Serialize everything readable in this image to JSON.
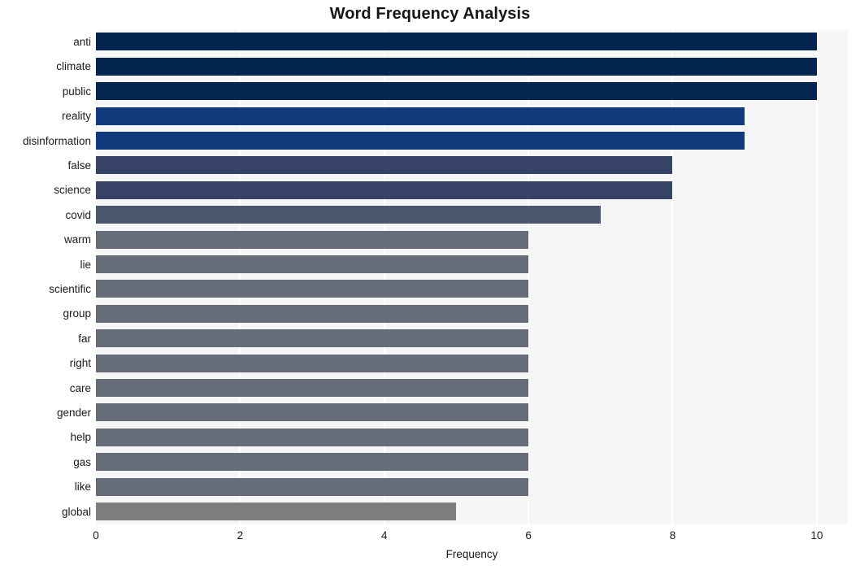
{
  "chart_data": {
    "type": "bar",
    "orientation": "horizontal",
    "title": "Word Frequency Analysis",
    "xlabel": "Frequency",
    "ylabel": "",
    "categories": [
      "anti",
      "climate",
      "public",
      "reality",
      "disinformation",
      "false",
      "science",
      "covid",
      "warm",
      "lie",
      "scientific",
      "group",
      "far",
      "right",
      "care",
      "gender",
      "help",
      "gas",
      "like",
      "global"
    ],
    "values": [
      10,
      10,
      10,
      9,
      9,
      8,
      8,
      7,
      6,
      6,
      6,
      6,
      6,
      6,
      6,
      6,
      6,
      6,
      6,
      5
    ],
    "bar_colors": [
      "#042450",
      "#042450",
      "#042550",
      "#103a7c",
      "#103a7c",
      "#374267",
      "#374267",
      "#4d566f",
      "#666c78",
      "#666c78",
      "#666c78",
      "#666c78",
      "#666c78",
      "#666c78",
      "#666c78",
      "#666c78",
      "#666c78",
      "#666c78",
      "#666c78",
      "#7e7e7d"
    ],
    "xlim": [
      0,
      10.43
    ],
    "xticks": [
      0,
      2,
      4,
      6,
      8,
      10
    ],
    "xtick_labels": [
      "0",
      "2",
      "4",
      "6",
      "8",
      "10"
    ],
    "grid": true,
    "grid_axis": "x",
    "grid_color": "#ffffff",
    "plot_background": "#f6f6f7",
    "figure_background": "#ffffff",
    "legend": null
  }
}
